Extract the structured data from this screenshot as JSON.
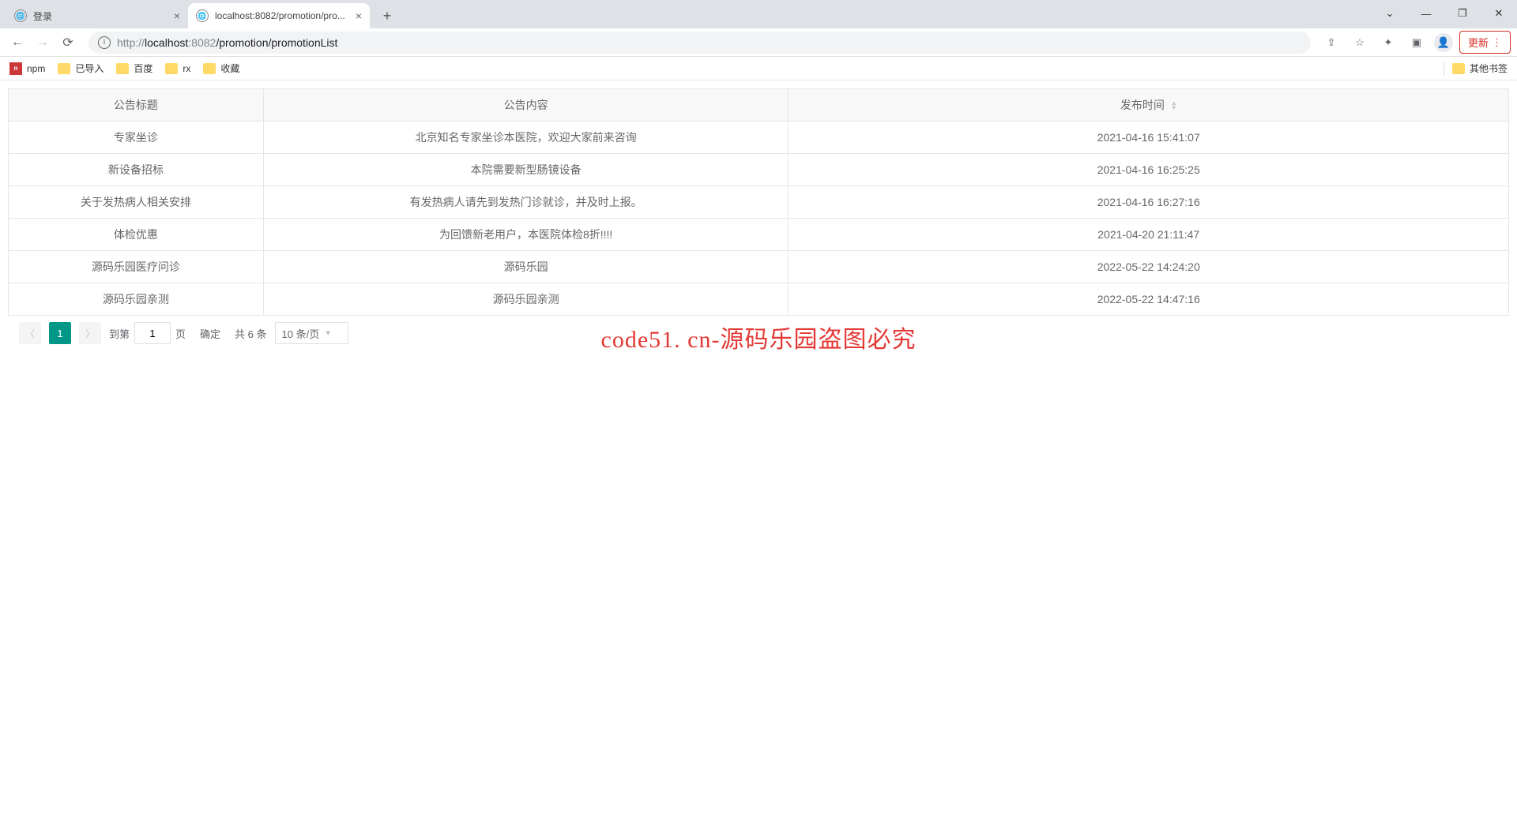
{
  "browser": {
    "tabs": [
      {
        "title": "登录",
        "active": false
      },
      {
        "title": "localhost:8082/promotion/pro...",
        "active": true
      }
    ],
    "url_prefix": "http://",
    "url_host": "localhost",
    "url_port": ":8082",
    "url_path": "/promotion/promotionList",
    "update_label": "更新"
  },
  "bookmarks": {
    "items": [
      "npm",
      "已导入",
      "百度",
      "rx",
      "收藏"
    ],
    "other": "其他书签"
  },
  "table": {
    "headers": {
      "title": "公告标题",
      "content": "公告内容",
      "time": "发布时间"
    },
    "rows": [
      {
        "title": "专家坐诊",
        "content": "北京知名专家坐诊本医院，欢迎大家前来咨询",
        "time": "2021-04-16 15:41:07"
      },
      {
        "title": "新设备招标",
        "content": "本院需要新型肠镜设备",
        "time": "2021-04-16 16:25:25"
      },
      {
        "title": "关于发热病人相关安排",
        "content": "有发热病人请先到发热门诊就诊，并及时上报。",
        "time": "2021-04-16 16:27:16"
      },
      {
        "title": "体检优惠",
        "content": "为回馈新老用户，本医院体检8折!!!!",
        "time": "2021-04-20 21:11:47"
      },
      {
        "title": "源码乐园医疗问诊",
        "content": "源码乐园",
        "time": "2022-05-22 14:24:20"
      },
      {
        "title": "源码乐园亲测",
        "content": "源码乐园亲测",
        "time": "2022-05-22 14:47:16"
      }
    ]
  },
  "pagination": {
    "current": "1",
    "goto_prefix": "到第",
    "goto_value": "1",
    "goto_suffix": "页",
    "confirm": "确定",
    "total": "共 6 条",
    "per_page": "10 条/页"
  },
  "watermark": "code51. cn-源码乐园盗图必究"
}
